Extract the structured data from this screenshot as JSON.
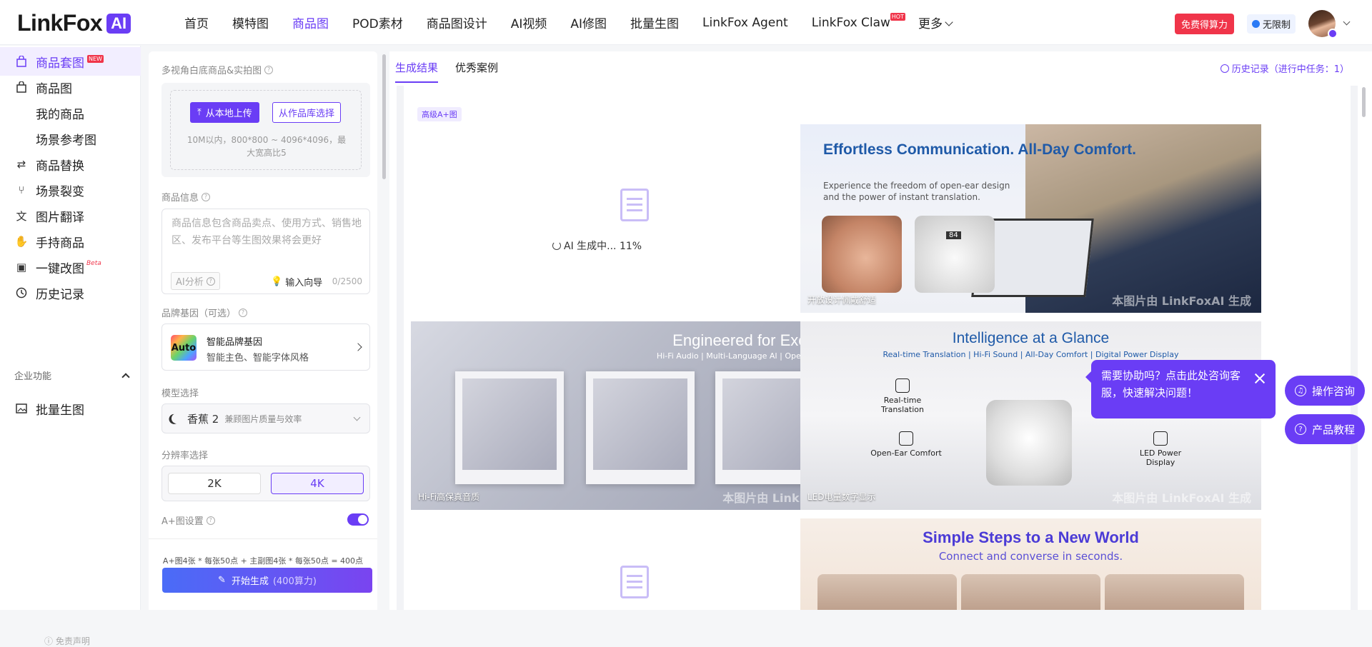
{
  "brand": {
    "name": "LinkFox",
    "badge": "AI"
  },
  "nav": {
    "items": [
      {
        "label": "首页"
      },
      {
        "label": "模特图"
      },
      {
        "label": "商品图"
      },
      {
        "label": "POD素材"
      },
      {
        "label": "商品图设计"
      },
      {
        "label": "AI视频"
      },
      {
        "label": "AI修图"
      },
      {
        "label": "批量生图"
      },
      {
        "label": "LinkFox Agent"
      },
      {
        "label": "LinkFox Claw",
        "tag": "HOT"
      },
      {
        "label": "更多"
      }
    ],
    "active": "商品图"
  },
  "header_right": {
    "free_label": "免费得算力",
    "unlimited_label": "无限制"
  },
  "sidebar": {
    "items": [
      {
        "label": "商品套图",
        "tag": "NEW",
        "icon": "bag-icon"
      },
      {
        "label": "商品图",
        "icon": "bag-outline-icon"
      },
      {
        "label": "我的商品"
      },
      {
        "label": "场景参考图"
      },
      {
        "label": "商品替换",
        "icon": "swap-icon"
      },
      {
        "label": "场景裂变",
        "icon": "split-icon"
      },
      {
        "label": "图片翻译",
        "icon": "translate-icon"
      },
      {
        "label": "手持商品",
        "icon": "hand-icon"
      },
      {
        "label": "一键改图",
        "tag": "Beta",
        "icon": "edit-image-icon"
      },
      {
        "label": "历史记录",
        "icon": "clock-icon"
      }
    ],
    "section_label": "企业功能",
    "section_items": [
      {
        "label": "批量生图",
        "icon": "image-icon"
      }
    ],
    "disclaimer": "免责声明"
  },
  "panel": {
    "upload_label": "多视角白底商品&实拍图",
    "upload_btn": "从本地上传",
    "library_btn": "从作品库选择",
    "upload_hint": "10M以内，800*800 ~ 4096*4096，最大宽高比5",
    "info_label": "商品信息",
    "info_placeholder": "商品信息包含商品卖点、使用方式、销售地区、发布平台等生图效果将会更好",
    "ai_analyze": "AI分析",
    "guide": "输入向导",
    "count": "0/2500",
    "brand_label": "品牌基因（可选）",
    "brand_icon_text": "Auto",
    "brand_title": "智能品牌基因",
    "brand_sub": "智能主色、智能字体风格",
    "model_label": "模型选择",
    "model_name": "香蕉 2",
    "model_desc": "兼顾图片质量与效率",
    "res_label": "分辨率选择",
    "res_options": [
      "2K",
      "4K"
    ],
    "res_selected": "4K",
    "aplus_label": "A+图设置",
    "aplus_enabled": true,
    "formula": "A+图4张 * 每张50点 + 主副图4张 * 每张50点 = 400点",
    "generate_label": "开始生成",
    "generate_points": "(400算力)"
  },
  "content": {
    "tabs": [
      "生成结果",
      "优秀案例"
    ],
    "active_tab": "生成结果",
    "history": "历史记录（进行中任务：1）",
    "tag": "高级A+图",
    "status": "AI 生成中... 11%",
    "progress_percent": 11,
    "cards": [
      {
        "title": "Effortless Communication. All-Day Comfort.",
        "subtitle": "Experience the freedom of open-ear design and the power of instant translation.",
        "caption": "开放设计佩戴舒适",
        "case_display": "84"
      },
      {
        "title": "Engineered for Excellence",
        "subtitle": "Hi-Fi Audio | Multi-Language AI | Open-Ear Comfort",
        "caption": "Hi-Fi高保真音质"
      },
      {
        "title": "Intelligence at a Glance",
        "subtitle": "Real-time Translation | Hi-Fi Sound | All-Day Comfort | Digital Power Display",
        "caption": "LED电量数字显示",
        "features": [
          "Real-time Translation",
          "Open-Ear Comfort",
          "LED Power Display"
        ]
      },
      {
        "title": "Simple Steps to a New World",
        "subtitle": "Connect and converse in seconds."
      }
    ],
    "watermark": "本图片由 LinkFoxAI 生成"
  },
  "support": {
    "tooltip": "需要协助吗？点击此处咨询客服，快速解决问题！",
    "consult": "操作咨询",
    "tutorial": "产品教程"
  },
  "colors": {
    "accent": "#6a3df5",
    "hot": "#f0354a",
    "title_blue": "#1f5aa8"
  }
}
